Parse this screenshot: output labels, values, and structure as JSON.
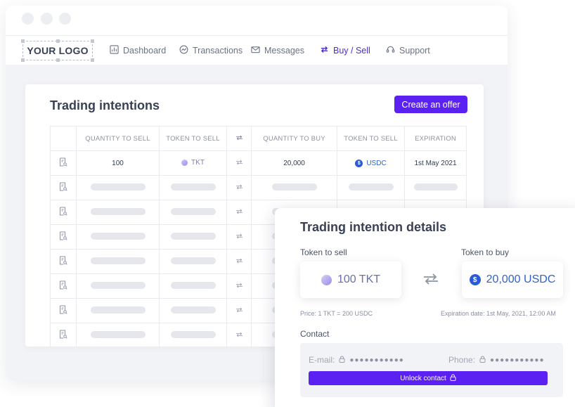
{
  "window": {
    "controls": [
      "close",
      "minimize",
      "maximize"
    ]
  },
  "nav": {
    "logo": "YOUR LOGO",
    "items": [
      {
        "label": "Dashboard",
        "icon": "chart-icon"
      },
      {
        "label": "Transactions",
        "icon": "clock-icon"
      },
      {
        "label": "Messages",
        "icon": "envelope-icon"
      },
      {
        "label": "Buy / Sell",
        "icon": "swap-icon",
        "active": true
      },
      {
        "label": "Support",
        "icon": "headset-icon"
      }
    ]
  },
  "trading": {
    "title": "Trading intentions",
    "create_button": "Create an offer",
    "columns": [
      "QUANTITY TO SELL",
      "TOKEN TO SELL",
      "QUANTITY TO BUY",
      "TOKEN TO SELL",
      "EXPIRATION"
    ],
    "rows": [
      {
        "quantity_to_sell": "100",
        "token_to_sell": "TKT",
        "quantity_to_buy": "20,000",
        "token_to_buy": "USDC",
        "expiration": "1st May 2021"
      }
    ],
    "placeholder_rows": 7
  },
  "details": {
    "title": "Trading intention details",
    "token_to_sell_label": "Token to sell",
    "token_to_buy_label": "Token to buy",
    "sell_value": "100 TKT",
    "buy_value": "20,000 USDC",
    "usdc_symbol": "$",
    "price": "Price: 1 TKT = 200 USDC",
    "expiration": "Expiration date: 1st May, 2021, 12:00 AM",
    "contact_label": "Contact",
    "email_label": "E-mail:",
    "email_masked": "●●●●●●●●●●●",
    "phone_label": "Phone:",
    "phone_masked": "●●●●●●●●●●●",
    "unlock_button": "Unlock contact"
  },
  "colors": {
    "accent": "#5b21f2",
    "active_nav": "#4e2bd9",
    "usdc": "#2a5bd7",
    "tkt": "#9d8fe8"
  }
}
